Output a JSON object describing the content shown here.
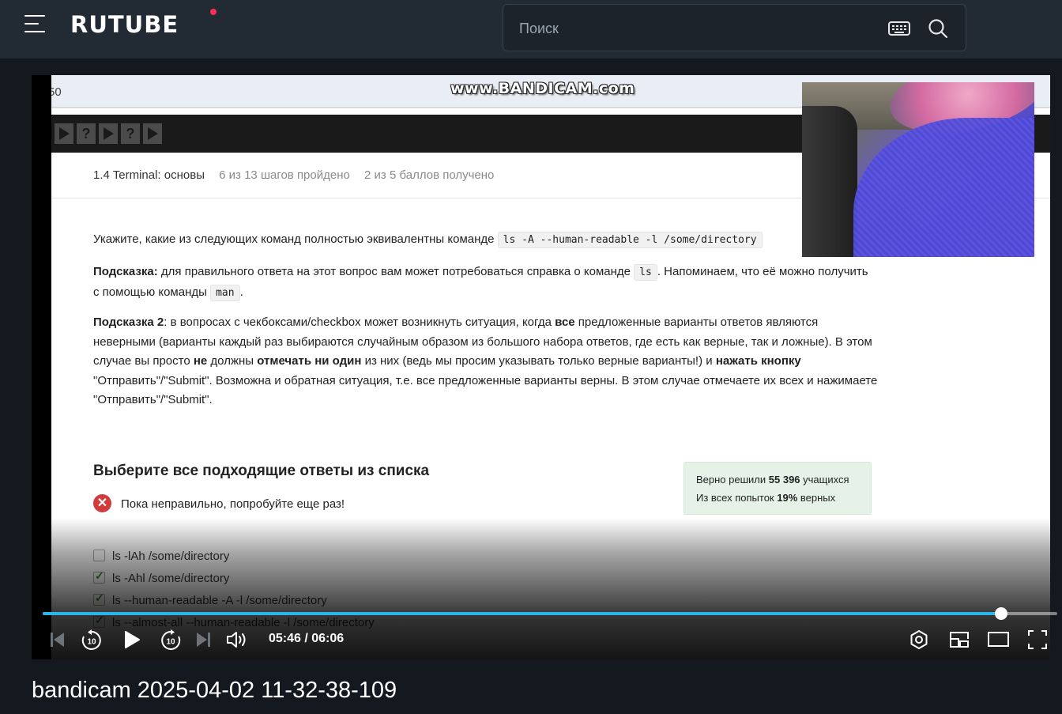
{
  "header": {
    "logo_text": "RUTUBE",
    "search_placeholder": "Поиск",
    "icons": [
      "menu-icon",
      "keyboard-icon",
      "search-icon"
    ],
    "accent_color": "#ff2e55"
  },
  "video_frame": {
    "url_fragment": "50",
    "watermark": "www.BANDICAM.com",
    "step_markers": [
      "?",
      "?"
    ],
    "breadcrumb": {
      "lesson": "1.4 Terminal: основы",
      "steps": "6 из 13 шагов пройдено",
      "score": "2 из 5 баллов  получено"
    },
    "question": {
      "intro": "Укажите, какие из следующих команд полностью эквивалентны команде",
      "command": "ls -A --human-readable -l /some/directory"
    },
    "hint1": {
      "label": "Подсказка:",
      "text_a": " для правильного ответа на этот вопрос вам может потребоваться справка о команде ",
      "code_ls": "ls",
      "text_b": ". Напоминаем, что её можно получить с помощью команды ",
      "code_man": "man",
      "text_c": "."
    },
    "hint2": {
      "label": "Подсказка 2",
      "p1": ": в вопросах с чекбоксами/checkbox может возникнуть ситуация, когда ",
      "b1": "все",
      "p2": " предложенные варианты ответов являются неверными (варианты каждый раз выбираются случайным образом из большого набора ответов, где есть как верные, так и ложные). В этом случае вы просто ",
      "b2": "не",
      "p3": " должны ",
      "b3": "отмечать ни один",
      "p4": " из них (ведь мы просим указывать только верные варианты!) и ",
      "b4": "нажать кнопку",
      "p5": " \"Отправить\"/\"Submit\". Возможна и обратная ситуация, т.е. все предложенные варианты верны. В этом случае отмечаете их всех и нажимаете \"Отправить\"/\"Submit\"."
    },
    "answers_title": "Выберите все подходящие ответы из списка",
    "feedback": "Пока неправильно, попробуйте еще раз!",
    "stats": {
      "solved_prefix": "Верно решили ",
      "solved_count": "55 396",
      "solved_suffix": " учащихся",
      "attempts_prefix": "Из всех попыток ",
      "attempts_pct": "19%",
      "attempts_suffix": " верных"
    },
    "options": [
      {
        "label": "ls -lAh /some/directory",
        "checked": false
      },
      {
        "label": "ls -Ahl /some/directory",
        "checked": true
      },
      {
        "label": "ls --human-readable -A  -l /some/directory",
        "checked": true
      },
      {
        "label": "ls --almost-all --human-readable -l /some/directory",
        "checked": true
      }
    ]
  },
  "player": {
    "current_time": "05:46",
    "duration": "06:06",
    "time_display": "05:46 / 06:06",
    "progress_fraction": 0.945,
    "progress_color": "#2cb5ea",
    "skip_seconds": "10",
    "controls": [
      "previous-icon",
      "rewind-10-icon",
      "play-icon",
      "forward-10-icon",
      "next-icon",
      "volume-icon",
      "settings-icon",
      "miniplayer-icon",
      "theater-mode-icon",
      "fullscreen-icon"
    ]
  },
  "video_title": "bandicam 2025-04-02 11-32-38-109"
}
